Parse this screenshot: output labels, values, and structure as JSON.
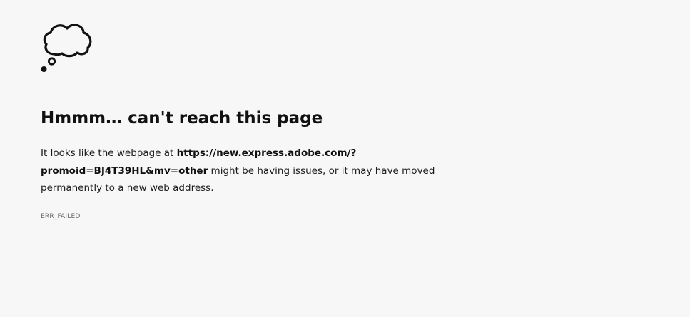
{
  "icon": "thought-bubble-icon",
  "title": "Hmmm… can't reach this page",
  "description": {
    "prefix": "It looks like the webpage at ",
    "url": "https://new.express.adobe.com/?promoid=BJ4T39HL&mv=other",
    "suffix": " might be having issues, or it may have moved permanently to a new web address."
  },
  "error_code": "ERR_FAILED",
  "colors": {
    "background": "#f7f7f7",
    "text": "#1b1b1b",
    "error_code": "#666666"
  }
}
